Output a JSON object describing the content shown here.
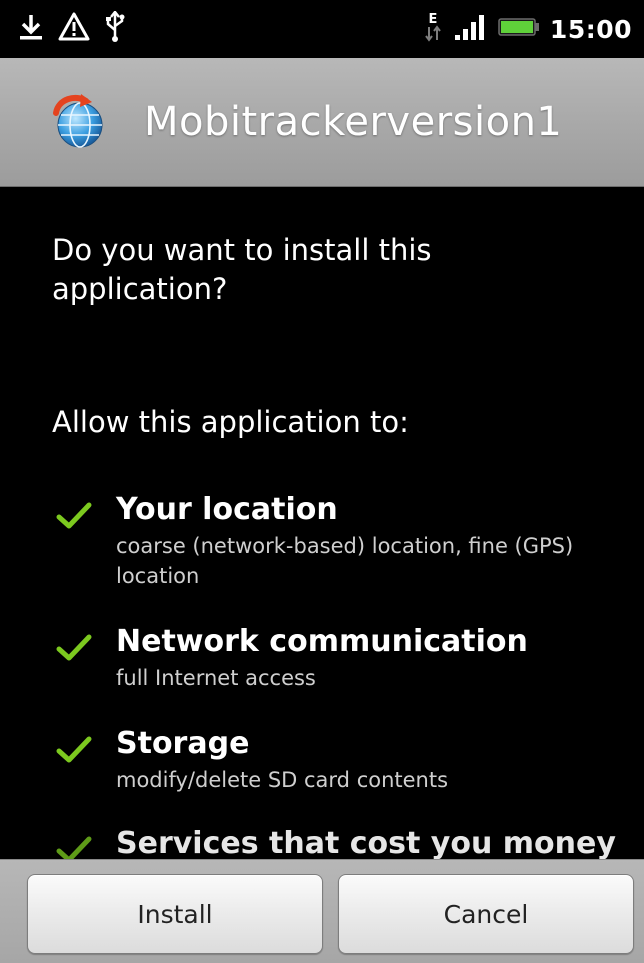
{
  "status_bar": {
    "time": "15:00",
    "network_type": "E",
    "icons": [
      "download-icon",
      "warning-icon",
      "usb-icon",
      "data-edge-icon",
      "signal-icon",
      "battery-icon"
    ]
  },
  "title_bar": {
    "app_name": "Mobitrackerversion1",
    "app_icon": "globe-app-icon"
  },
  "content": {
    "question": "Do you want to install this application?",
    "allow_heading": "Allow this application to:",
    "permissions": [
      {
        "title": "Your location",
        "description": "coarse (network-based) location, fine (GPS) location"
      },
      {
        "title": "Network communication",
        "description": "full Internet access"
      },
      {
        "title": "Storage",
        "description": "modify/delete SD card contents"
      },
      {
        "title": "Services that cost you money",
        "description": ""
      }
    ]
  },
  "buttons": {
    "install": "Install",
    "cancel": "Cancel"
  },
  "colors": {
    "check_green": "#7cc91f",
    "title_bar_gray": "#a9a9a9",
    "battery_green": "#5fd13a"
  }
}
